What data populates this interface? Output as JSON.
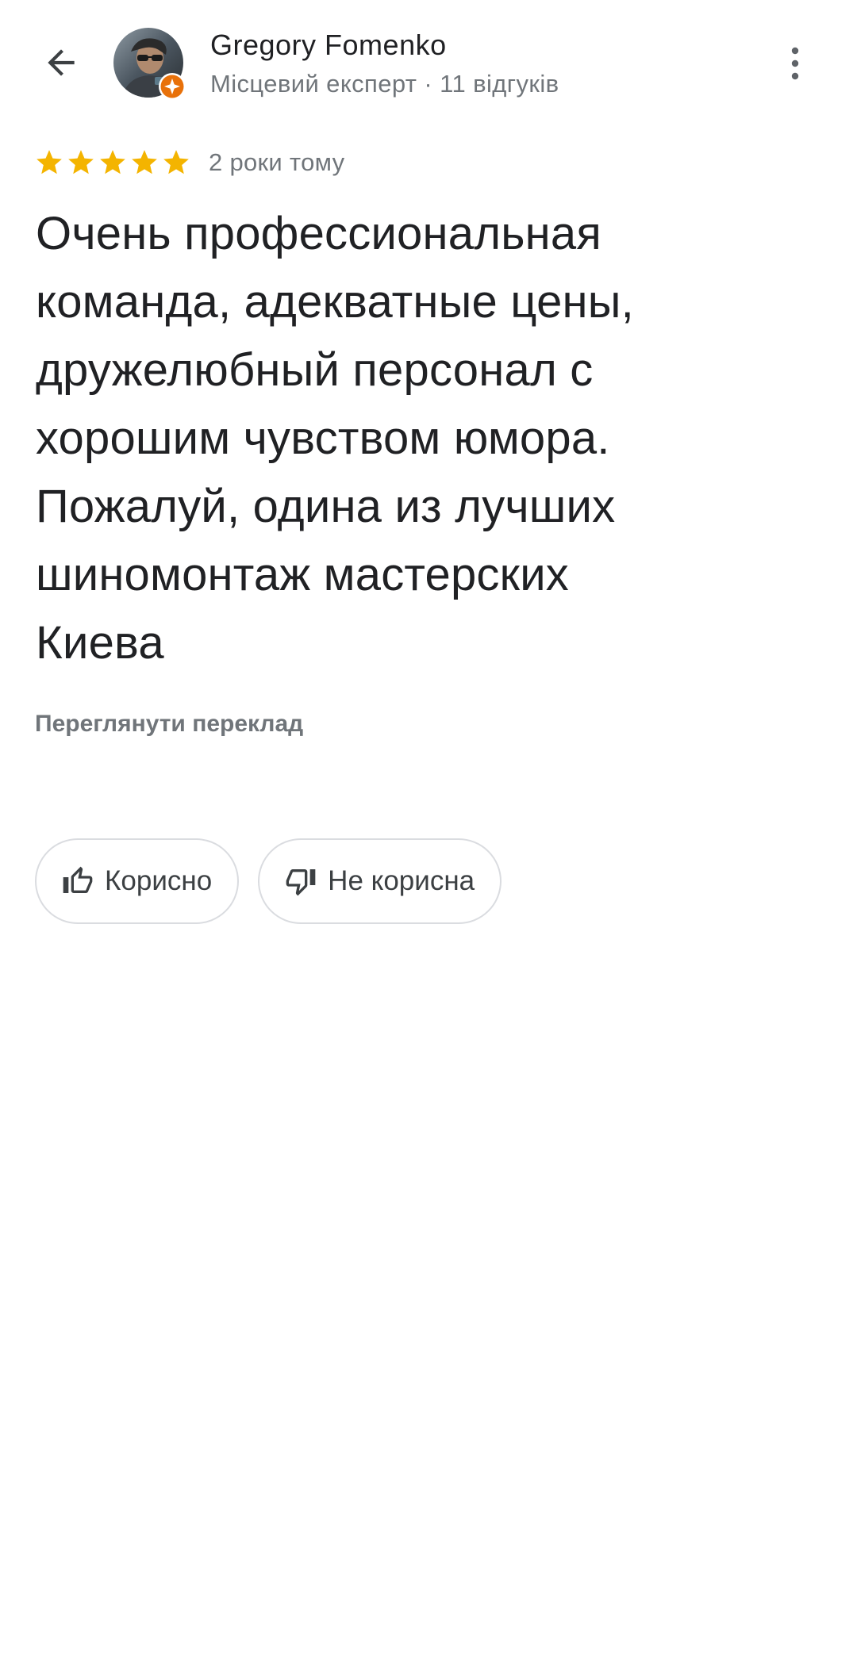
{
  "header": {
    "author_name": "Gregory Fomenko",
    "author_meta": "Місцевий експерт · 11 відгуків",
    "back_icon": "arrow-back-icon",
    "more_icon": "more-vert-icon"
  },
  "review": {
    "rating": 5,
    "max_rating": 5,
    "date": "2 роки тому",
    "text_lines": [
      "Очень профессиональная",
      "команда, адекватные цены,",
      "дружелюбный персонал с",
      "хорошим чувством юмора.",
      "Пожалуй, одина из лучших",
      "шиномонтаж мастерских",
      "Киева"
    ],
    "translate_label": "Переглянути переклад"
  },
  "feedback": {
    "helpful_label": "Корисно",
    "not_helpful_label": "Не корисна"
  },
  "colors": {
    "star": "#f4b400",
    "badge": "#e8710a",
    "secondary_text": "#70757a",
    "primary_text": "#202124",
    "chip_border": "#dadce0"
  }
}
